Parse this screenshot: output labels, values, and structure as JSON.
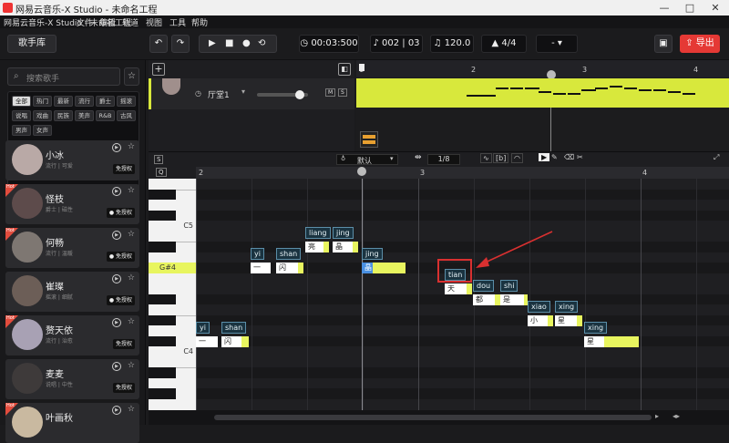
{
  "window": {
    "title": "网易云音乐-X Studio - 未命名工程",
    "minimize": "—",
    "maximize": "□",
    "close": "✕"
  },
  "menu": [
    "文件",
    "编辑",
    "轨道",
    "视图",
    "工具",
    "帮助"
  ],
  "toolbar": {
    "singer_library": "歌手库",
    "time": "00:03:500",
    "bar_beat": "002 | 03",
    "tempo": "120.0",
    "time_signature": "4/4",
    "key": "-",
    "export": "导出"
  },
  "left_panel": {
    "search_placeholder": "搜索歌手",
    "filters": [
      [
        "全部",
        "热门",
        "最新",
        "流行",
        "爵士",
        "摇滚"
      ],
      [
        "说唱",
        "戏曲",
        "民族",
        "美声",
        "R&B",
        "古风"
      ],
      [
        "男声",
        "女声"
      ]
    ],
    "singers": [
      {
        "name": "小冰",
        "tags": "流行 | 可爱",
        "badge": "免授权",
        "hot": false,
        "avatar_color": "#b9a9a6"
      },
      {
        "name": "怪枝",
        "tags": "爵士 | 磁性",
        "badge": "● 免授权",
        "hot": true,
        "hot_label": "Hot",
        "avatar_color": "#5d4b4b"
      },
      {
        "name": "何畅",
        "tags": "流行 | 温暖",
        "badge": "● 免授权",
        "hot": true,
        "hot_label": "Hot",
        "avatar_color": "#7e7772"
      },
      {
        "name": "崔璨",
        "tags": "摇滚 | 细腻",
        "badge": "● 免授权",
        "hot": false,
        "avatar_color": "#6c5e57"
      },
      {
        "name": "赘天依",
        "tags": "流行 | 治愈",
        "badge": "免授权",
        "hot": true,
        "hot_label": "Hot",
        "avatar_color": "#a8a1b4"
      },
      {
        "name": "麦麦",
        "tags": "说唱 | 中性",
        "badge": "免授权",
        "hot": false,
        "avatar_color": "#3e3a3a"
      },
      {
        "name": "叶画秋",
        "tags": "",
        "badge": "",
        "hot": true,
        "hot_label": "Hot",
        "avatar_color": "#c9b9a0"
      }
    ]
  },
  "track": {
    "name": "厅堂1",
    "mute": "M",
    "solo": "S"
  },
  "overview": {
    "ruler": [
      "1",
      "2",
      "3",
      "4"
    ]
  },
  "piano_roll": {
    "tool_label": "S",
    "snap": "默认",
    "quantize": "1/8",
    "quantize_label": "Q",
    "ruler": [
      "2",
      "3",
      "4"
    ],
    "key_labels": {
      "c5": "C5",
      "c4": "C4",
      "current": "G#4"
    },
    "notes": [
      {
        "lyric": "一",
        "pinyin": "yi"
      },
      {
        "lyric": "闪",
        "pinyin": "shan"
      },
      {
        "lyric": "一",
        "pinyin": "yi"
      },
      {
        "lyric": "闪",
        "pinyin": "shan"
      },
      {
        "lyric": "亮",
        "pinyin": "liang"
      },
      {
        "lyric": "晶",
        "pinyin": "jing"
      },
      {
        "lyric": "晶",
        "pinyin": "jing"
      },
      {
        "lyric": "天",
        "pinyin": "tian"
      },
      {
        "lyric": "都",
        "pinyin": "dou"
      },
      {
        "lyric": "是",
        "pinyin": "shi"
      },
      {
        "lyric": "小",
        "pinyin": "xiao"
      },
      {
        "lyric": "星",
        "pinyin": "xing"
      },
      {
        "lyric": "星",
        "pinyin": "xing"
      }
    ]
  },
  "colors": {
    "accent": "#d8e83c",
    "export": "#e53935",
    "highlight": "#d93030"
  }
}
